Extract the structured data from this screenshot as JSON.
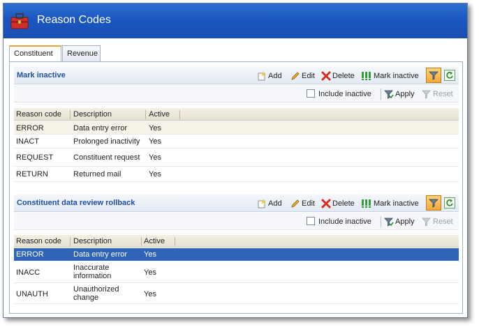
{
  "window": {
    "title": "Reason Codes"
  },
  "tabs": [
    {
      "label": "Constituent",
      "active": true
    },
    {
      "label": "Revenue",
      "active": false
    }
  ],
  "toolbar": {
    "add": "Add",
    "edit": "Edit",
    "delete": "Delete",
    "mark_inactive": "Mark inactive",
    "include_inactive": "Include inactive",
    "apply": "Apply",
    "reset": "Reset"
  },
  "columns": [
    "Reason code",
    "Description",
    "Active"
  ],
  "sections": [
    {
      "title": "Mark inactive",
      "rows": [
        {
          "code": "ERROR",
          "description": "Data entry error",
          "active": "Yes"
        },
        {
          "code": "INACT",
          "description": "Prolonged inactivity",
          "active": "Yes"
        },
        {
          "code": "REQUEST",
          "description": "Constituent request",
          "active": "Yes"
        },
        {
          "code": "RETURN",
          "description": "Returned mail",
          "active": "Yes"
        }
      ]
    },
    {
      "title": "Constituent data review rollback",
      "rows": [
        {
          "code": "ERROR",
          "description": "Data entry error",
          "active": "Yes",
          "selected": true
        },
        {
          "code": "INACC",
          "description_line1": "Inaccurate",
          "description_line2": "information",
          "active": "Yes"
        },
        {
          "code": "UNAUTH",
          "description_line1": "Unauthorized",
          "description_line2": "change",
          "active": "Yes"
        }
      ]
    }
  ],
  "colors": {
    "title_bar": "#1a57c0",
    "section_title": "#1d4fa5",
    "selected_row": "#2e63b5",
    "filter_button": "#f1a938"
  },
  "icons": [
    "toolbox-icon",
    "add-icon",
    "edit-icon",
    "delete-icon",
    "mark-inactive-icon",
    "filter-icon",
    "refresh-icon",
    "apply-filter-icon",
    "reset-filter-icon"
  ]
}
